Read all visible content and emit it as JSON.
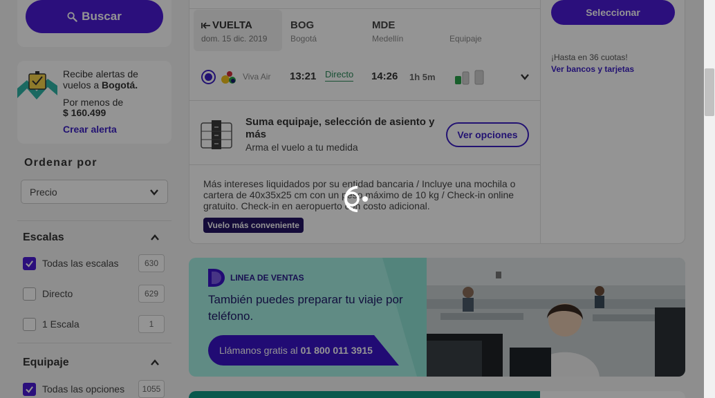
{
  "sidebar": {
    "search_label": "Buscar",
    "alert": {
      "text_prefix": "Recibe alertas de vuelos a ",
      "destination": "Bogotá.",
      "price_label": "Por menos de",
      "price": "$ 160.499",
      "link": "Crear alerta"
    },
    "sort": {
      "title": "Ordenar por",
      "selected": "Precio"
    },
    "stops": {
      "title": "Escalas",
      "options": [
        {
          "label": "Todas las escalas",
          "count": "630",
          "checked": true
        },
        {
          "label": "Directo",
          "count": "629",
          "checked": false
        },
        {
          "label": "1 Escala",
          "count": "1",
          "checked": false
        }
      ]
    },
    "baggage": {
      "title": "Equipaje",
      "options": [
        {
          "label": "Todas las opciones",
          "count": "1055",
          "checked": true
        }
      ]
    }
  },
  "flight": {
    "direction": "VUELTA",
    "date": "dom. 15 dic. 2019",
    "origin": {
      "code": "BOG",
      "name": "Bogotá"
    },
    "destination": {
      "code": "MDE",
      "name": "Medellín"
    },
    "baggage_header": "Equipaje",
    "airline": "Viva Air",
    "depart": "13:21",
    "stops": "Directo",
    "arrive": "14:26",
    "duration": "1h 5m",
    "extras_title": "Suma equipaje, selección de asiento y más",
    "extras_sub": "Arma el vuelo a tu medida",
    "extras_button": "Ver opciones",
    "note": "Más intereses liquidados por su entidad bancaria / Incluye una mochila o cartera de 40x35x25 cm con un peso máximo de 10 kg / Check-in online gratuito. Check-in en aeropuerto con costo adicional.",
    "badge": "Vuelo más conveniente",
    "select_button": "Seleccionar",
    "installments": "¡Hasta en 36 cuotas!",
    "banks_link": "Ver bancos y tarjetas"
  },
  "banner": {
    "tag": "LINEA DE VENTAS",
    "text": "También puedes preparar tu viaje por teléfono.",
    "call_prefix": "Llámanos gratis al",
    "phone": "01 800 011 3915"
  },
  "colors": {
    "primary": "#4a1ad6",
    "link": "#3b1fc4",
    "direct_green": "#2b8a5a",
    "banner_bg": "#a6efe3",
    "overlay": "rgba(0,0,0,0.42)"
  }
}
